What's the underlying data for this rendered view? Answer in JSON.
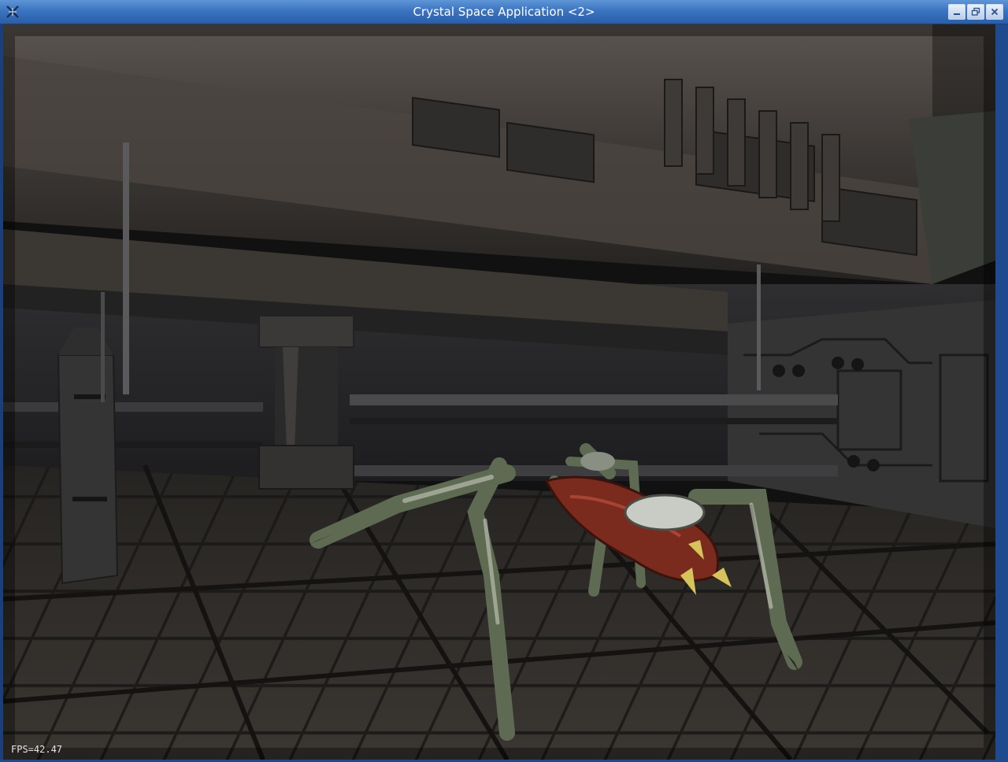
{
  "window": {
    "title": "Crystal Space Application <2>",
    "app_icon": "crystal-space-icon",
    "controls": [
      {
        "name": "minimize",
        "icon": "minimize-icon"
      },
      {
        "name": "restore",
        "icon": "restore-icon"
      },
      {
        "name": "close",
        "icon": "close-icon"
      }
    ],
    "colors": {
      "titlebar": "#3b74c0",
      "frame": "#1f4a8e"
    }
  },
  "viewport": {
    "scene": "3d-render",
    "fps_text": "FPS=42.47"
  }
}
